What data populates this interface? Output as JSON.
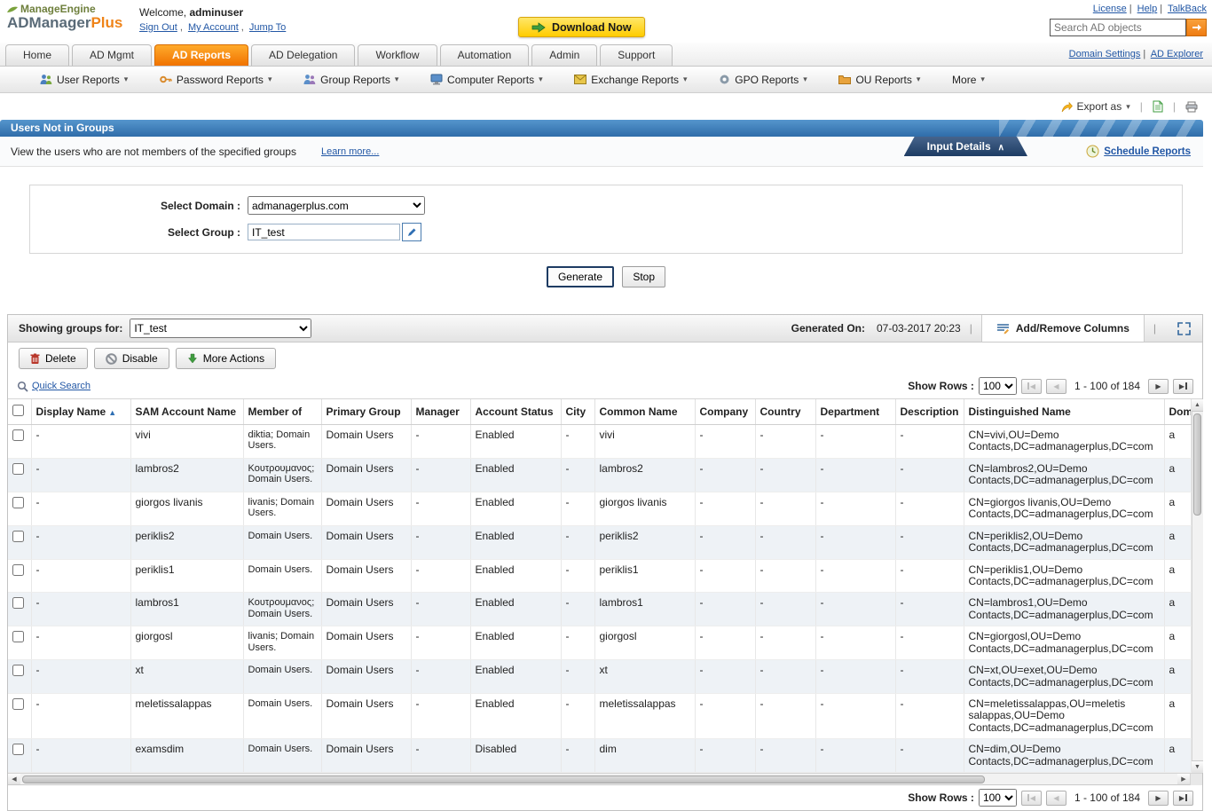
{
  "header": {
    "logo_line1": "ManageEngine",
    "logo_line2_a": "ADManager",
    "logo_line2_b": "Plus",
    "welcome_label": "Welcome,",
    "username": "adminuser",
    "links": [
      {
        "label": "Sign Out"
      },
      {
        "label": "My Account"
      },
      {
        "label": "Jump To"
      }
    ],
    "download_label": "Download Now",
    "top_links": [
      {
        "label": "License"
      },
      {
        "label": "Help"
      },
      {
        "label": "TalkBack"
      }
    ],
    "search_placeholder": "Search AD objects"
  },
  "tabs": [
    {
      "label": "Home"
    },
    {
      "label": "AD Mgmt"
    },
    {
      "label": "AD Reports"
    },
    {
      "label": "AD Delegation"
    },
    {
      "label": "Workflow"
    },
    {
      "label": "Automation"
    },
    {
      "label": "Admin"
    },
    {
      "label": "Support"
    }
  ],
  "tab_links": [
    {
      "label": "Domain Settings"
    },
    {
      "label": "AD Explorer"
    }
  ],
  "menus": [
    {
      "label": "User Reports"
    },
    {
      "label": "Password Reports"
    },
    {
      "label": "Group Reports"
    },
    {
      "label": "Computer Reports"
    },
    {
      "label": "Exchange Reports"
    },
    {
      "label": "GPO Reports"
    },
    {
      "label": "OU Reports"
    },
    {
      "label": "More"
    }
  ],
  "toolbar": {
    "export_label": "Export as"
  },
  "report": {
    "title": "Users Not in Groups",
    "description": "View the users who are not members of the specified groups",
    "learn_more": "Learn more...",
    "input_details": "Input Details",
    "schedule_reports": "Schedule Reports",
    "select_domain_label": "Select Domain :",
    "domain_value": "admanagerplus.com",
    "select_group_label": "Select Group :",
    "group_value": "IT_test",
    "generate_label": "Generate",
    "stop_label": "Stop"
  },
  "results": {
    "showing_label": "Showing groups for:",
    "showing_value": "IT_test",
    "generated_label": "Generated On:",
    "generated_value": "07-03-2017 20:23",
    "add_remove_columns": "Add/Remove Columns",
    "actions": [
      {
        "label": "Delete"
      },
      {
        "label": "Disable"
      },
      {
        "label": "More Actions"
      }
    ],
    "quick_search": "Quick Search",
    "show_rows_label": "Show Rows :",
    "show_rows_value": "100",
    "pagination": "1 - 100 of 184"
  },
  "table": {
    "columns": [
      "Display Name",
      "SAM Account Name",
      "Member of",
      "Primary Group",
      "Manager",
      "Account Status",
      "City",
      "Common Name",
      "Company",
      "Country",
      "Department",
      "Description",
      "Distinguished Name",
      "Dom"
    ],
    "rows": [
      [
        "-",
        "vivi",
        "diktia; Domain Users.",
        "Domain Users",
        "-",
        "Enabled",
        "-",
        "vivi",
        "-",
        "-",
        "-",
        "-",
        "CN=vivi,OU=Demo Contacts,DC=admanagerplus,DC=com",
        "a"
      ],
      [
        "-",
        "lambros2",
        "Κουτρουμανος; Domain Users.",
        "Domain Users",
        "-",
        "Enabled",
        "-",
        "lambros2",
        "-",
        "-",
        "-",
        "-",
        "CN=lambros2,OU=Demo Contacts,DC=admanagerplus,DC=com",
        "a"
      ],
      [
        "-",
        "giorgos livanis",
        "livanis; Domain Users.",
        "Domain Users",
        "-",
        "Enabled",
        "-",
        "giorgos livanis",
        "-",
        "-",
        "-",
        "-",
        "CN=giorgos livanis,OU=Demo Contacts,DC=admanagerplus,DC=com",
        "a"
      ],
      [
        "-",
        "periklis2",
        "Domain Users.",
        "Domain Users",
        "-",
        "Enabled",
        "-",
        "periklis2",
        "-",
        "-",
        "-",
        "-",
        "CN=periklis2,OU=Demo Contacts,DC=admanagerplus,DC=com",
        "a"
      ],
      [
        "-",
        "periklis1",
        "Domain Users.",
        "Domain Users",
        "-",
        "Enabled",
        "-",
        "periklis1",
        "-",
        "-",
        "-",
        "-",
        "CN=periklis1,OU=Demo Contacts,DC=admanagerplus,DC=com",
        "a"
      ],
      [
        "-",
        "lambros1",
        "Κουτρουμανος; Domain Users.",
        "Domain Users",
        "-",
        "Enabled",
        "-",
        "lambros1",
        "-",
        "-",
        "-",
        "-",
        "CN=lambros1,OU=Demo Contacts,DC=admanagerplus,DC=com",
        "a"
      ],
      [
        "-",
        "giorgosl",
        "livanis; Domain Users.",
        "Domain Users",
        "-",
        "Enabled",
        "-",
        "giorgosl",
        "-",
        "-",
        "-",
        "-",
        "CN=giorgosl,OU=Demo Contacts,DC=admanagerplus,DC=com",
        "a"
      ],
      [
        "-",
        "xt",
        "Domain Users.",
        "Domain Users",
        "-",
        "Enabled",
        "-",
        "xt",
        "-",
        "-",
        "-",
        "-",
        "CN=xt,OU=exet,OU=Demo Contacts,DC=admanagerplus,DC=com",
        "a"
      ],
      [
        "-",
        "meletissalappas",
        "Domain Users.",
        "Domain Users",
        "-",
        "Enabled",
        "-",
        "meletissalappas",
        "-",
        "-",
        "-",
        "-",
        "CN=meletissalappas,OU=meletis salappas,OU=Demo Contacts,DC=admanagerplus,DC=com",
        "a"
      ],
      [
        "-",
        "examsdim",
        "Domain Users.",
        "Domain Users",
        "-",
        "Disabled",
        "-",
        "dim",
        "-",
        "-",
        "-",
        "-",
        "CN=dim,OU=Demo Contacts,DC=admanagerplus,DC=com",
        "a"
      ]
    ]
  }
}
